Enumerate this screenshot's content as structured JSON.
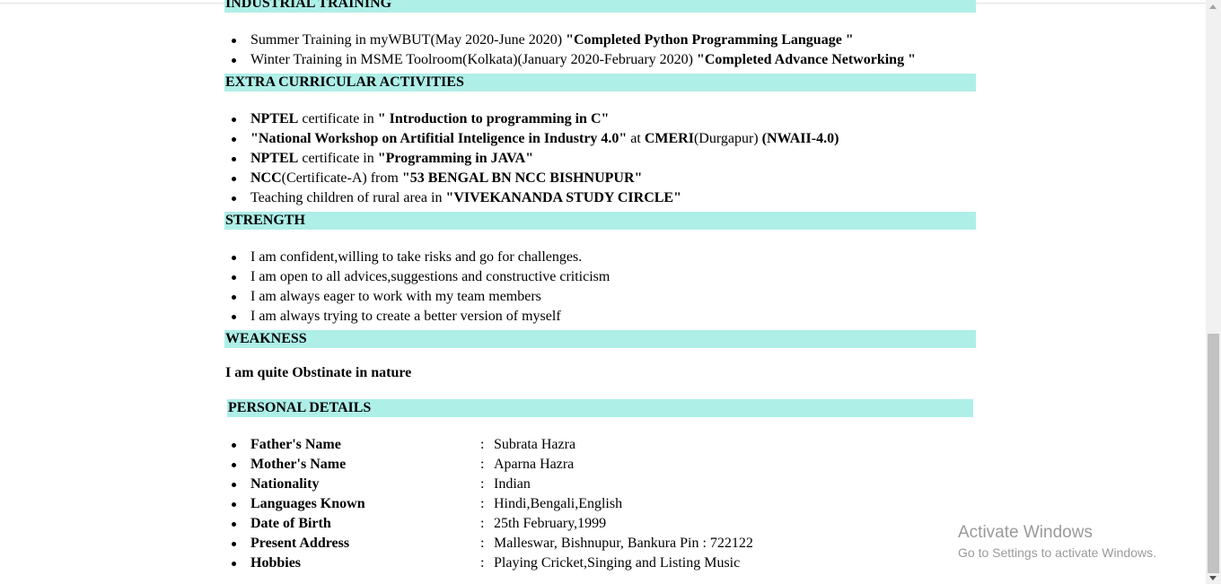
{
  "industrial_training": {
    "header": "INDUSTRIAL TRAINING",
    "items": [
      {
        "text": "Summer Training in myWBUT(May 2020-June 2020) ",
        "bold": "\"Completed Python Programming Language \""
      },
      {
        "text": "Winter Training in MSME Toolroom(Kolkata)(January 2020-February 2020) ",
        "bold": "\"Completed Advance Networking \""
      }
    ]
  },
  "extra_curricular": {
    "header": "EXTRA CURRICULAR ACTIVITIES",
    "items": [
      {
        "a_bold": "NPTEL",
        "b": " certificate in ",
        "c_bold": "\" Introduction to programming in C\""
      },
      {
        "a_bold": "\"National Workshop on Artifitial Inteligence in Industry 4.0\"",
        "b": " at ",
        "c_bold": "CMERI",
        "d": "(Durgapur) ",
        "e_bold": "(NWAII-4.0)"
      },
      {
        "a_bold": "NPTEL",
        "b": " certificate in ",
        "c_bold": "\"Programming in JAVA\""
      },
      {
        "a_bold": "NCC",
        "b": "(Certificate-A) from ",
        "c_bold": "\"53 BENGAL BN NCC BISHNUPUR\""
      },
      {
        "a": "Teaching children of rural area in ",
        "b_bold": "\"VIVEKANANDA STUDY CIRCLE\""
      }
    ]
  },
  "strength": {
    "header": "STRENGTH",
    "items": [
      "I am confident,willing to take risks and go for challenges.",
      "I am open to all advices,suggestions and constructive criticism",
      "I am always eager to work with my team members",
      "I am always trying to create a better version of myself"
    ]
  },
  "weakness": {
    "header": "WEAKNESS",
    "text": "I am quite Obstinate in nature"
  },
  "personal_details": {
    "header": "PERSONAL DETAILS",
    "colon": ":",
    "rows": [
      {
        "label": "Father's Name",
        "value": "Subrata Hazra"
      },
      {
        "label": "Mother's Name",
        "value": "Aparna Hazra"
      },
      {
        "label": "Nationality",
        "value": "Indian"
      },
      {
        "label": "Languages Known",
        "value": "Hindi,Bengali,English"
      },
      {
        "label": "Date of Birth",
        "value": "25th February,1999"
      },
      {
        "label": "Present Address",
        "value": "Malleswar, Bishnupur, Bankura Pin : 722122"
      },
      {
        "label": "Hobbies",
        "value": "Playing Cricket,Singing and Listing Music"
      }
    ]
  },
  "watermark": {
    "title": "Activate Windows",
    "subtitle": "Go to Settings to activate Windows."
  },
  "colors": {
    "section_header_bg": "#aeefe8",
    "watermark_text": "#9a9a9a",
    "scrollbar_thumb": "#c1c1c1"
  },
  "icons": [
    "scroll-up-arrow-icon",
    "scroll-down-arrow-icon"
  ]
}
